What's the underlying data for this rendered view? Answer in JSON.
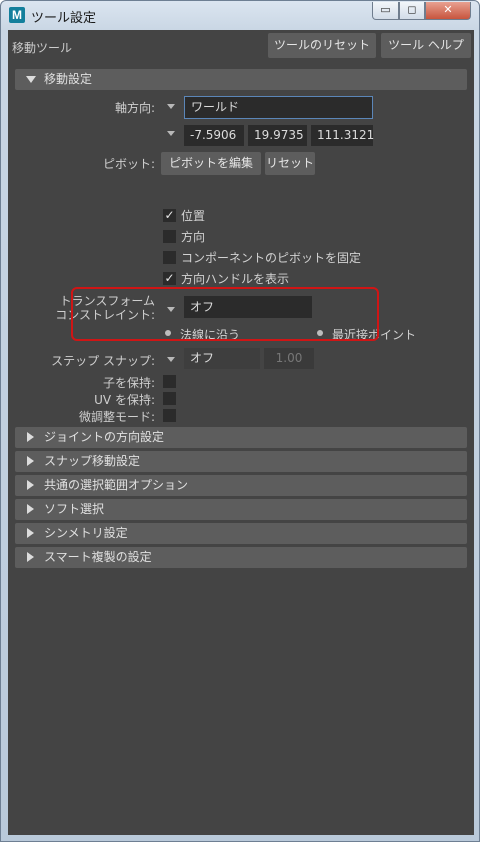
{
  "window": {
    "title": "ツール設定",
    "app_icon_letter": "M",
    "min_glyph": "▭",
    "max_glyph": "◻",
    "close_glyph": "✕"
  },
  "toolbar": {
    "tool_name": "移動ツール",
    "reset_label": "ツールのリセット",
    "help_label": "ツール ヘルプ"
  },
  "move_settings": {
    "header": "移動設定",
    "axis_label": "軸方向:",
    "axis_value": "ワールド",
    "coords": [
      "-7.5906",
      "19.9735",
      "111.3121"
    ],
    "pivot_label": "ピボット:",
    "edit_pivot_label": "ピボットを編集",
    "pivot_reset_label": "リセット",
    "options": [
      {
        "label": "位置",
        "checked": true
      },
      {
        "label": "方向",
        "checked": false
      },
      {
        "label": "コンポーネントのピボットを固定",
        "checked": false
      },
      {
        "label": "方向ハンドルを表示",
        "checked": true
      }
    ],
    "constraint_label_1": "トランスフォーム",
    "constraint_label_2": "コンストレイント:",
    "constraint_value": "オフ",
    "radio_normal": "法線に沿う",
    "radio_closest": "最近接ポイント",
    "step_snap_label": "ステップ スナップ:",
    "step_snap_value": "オフ",
    "step_snap_amount": "1.00",
    "preserve_children_label": "子を保持:",
    "preserve_uv_label": "UV を保持:",
    "tweak_mode_label": "微調整モード:"
  },
  "collapsed_sections": [
    "ジョイントの方向設定",
    "スナップ移動設定",
    "共通の選択範囲オプション",
    "ソフト選択",
    "シンメトリ設定",
    "スマート複製の設定"
  ],
  "colors": {
    "panel_bg": "#444444",
    "section_bg": "#5d5d5d",
    "field_bg": "#2b2b2b",
    "highlight": "#d01515"
  }
}
